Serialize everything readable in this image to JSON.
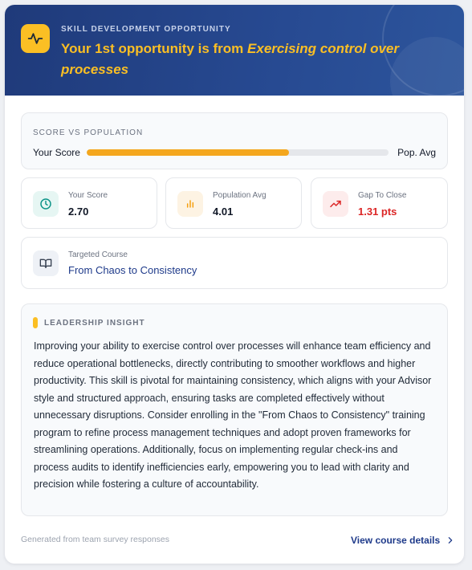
{
  "header": {
    "eyebrow": "SKILL DEVELOPMENT OPPORTUNITY",
    "title_prefix": "Your 1st opportunity is from ",
    "title_emphasis": "Exercising control over processes",
    "icon": "activity-icon",
    "accent": "#fbbf24",
    "background": "#1f3a7a"
  },
  "score_vs_population": {
    "label": "SCORE VS POPULATION",
    "your_label": "Your Score",
    "pop_label": "Pop. Avg",
    "fill_fraction": 0.67,
    "fill_color": "#f4a71e"
  },
  "stats": [
    {
      "label": "Your Score",
      "value": "2.70",
      "icon": "clock-icon",
      "color": "#0d9488"
    },
    {
      "label": "Population Avg",
      "value": "4.01",
      "icon": "bar-chart-icon",
      "color": "#f59e0b"
    },
    {
      "label": "Gap To Close",
      "value": "1.31 pts",
      "icon": "trending-up-icon",
      "color": "#dc2626"
    }
  ],
  "course": {
    "label": "Targeted Course",
    "name": "From Chaos to Consistency",
    "icon": "book-open-icon"
  },
  "insight": {
    "label": "LEADERSHIP INSIGHT",
    "text": "Improving your ability to exercise control over processes will enhance team efficiency and reduce operational bottlenecks, directly contributing to smoother workflows and higher productivity. This skill is pivotal for maintaining consistency, which aligns with your Advisor style and structured approach, ensuring tasks are completed effectively without unnecessary disruptions. Consider enrolling in the \"From Chaos to Consistency\" training program to refine process management techniques and adopt proven frameworks for streamlining operations. Additionally, focus on implementing regular check-ins and process audits to identify inefficiencies early, empowering you to lead with clarity and precision while fostering a culture of accountability."
  },
  "footer": {
    "note": "Generated from team survey responses",
    "link": "View course details",
    "link_icon": "chevron-right-icon"
  }
}
